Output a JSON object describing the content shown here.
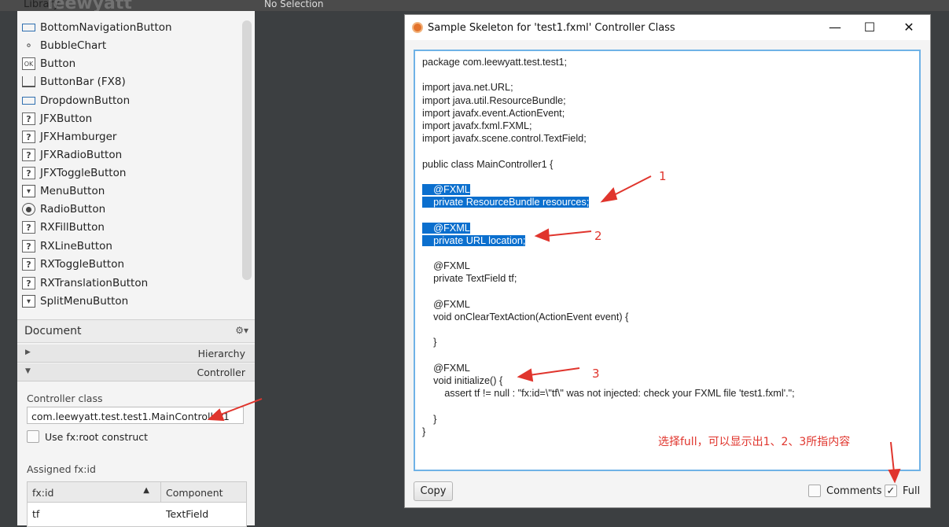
{
  "topbar": {
    "library_label": "Library",
    "watermark": "leewyatt",
    "status": "No Selection"
  },
  "library_items": [
    {
      "label": "BottomNavigationButton",
      "icon": "dropdown-icon"
    },
    {
      "label": "BubbleChart",
      "icon": "bubble-chart-icon"
    },
    {
      "label": "Button",
      "icon": "ok-button-icon"
    },
    {
      "label": "ButtonBar  (FX8)",
      "icon": "button-bar-icon"
    },
    {
      "label": "DropdownButton",
      "icon": "dropdown-icon"
    },
    {
      "label": "JFXButton",
      "icon": "unknown-component-icon"
    },
    {
      "label": "JFXHamburger",
      "icon": "unknown-component-icon"
    },
    {
      "label": "JFXRadioButton",
      "icon": "unknown-component-icon"
    },
    {
      "label": "JFXToggleButton",
      "icon": "unknown-component-icon"
    },
    {
      "label": "MenuButton",
      "icon": "menu-button-icon"
    },
    {
      "label": "RadioButton",
      "icon": "radio-icon"
    },
    {
      "label": "RXFillButton",
      "icon": "unknown-component-icon"
    },
    {
      "label": "RXLineButton",
      "icon": "unknown-component-icon"
    },
    {
      "label": "RXToggleButton",
      "icon": "unknown-component-icon"
    },
    {
      "label": "RXTranslationButton",
      "icon": "unknown-component-icon"
    },
    {
      "label": "SplitMenuButton",
      "icon": "menu-button-icon"
    }
  ],
  "document": {
    "title": "Document",
    "hierarchy": "Hierarchy",
    "controller": "Controller"
  },
  "controller": {
    "class_label": "Controller class",
    "class_value": "com.leewyatt.test.test1.MainController1",
    "root_label": "Use fx:root construct",
    "assigned_label": "Assigned fx:id",
    "col_fxid": "fx:id",
    "col_component": "Component",
    "rows": [
      {
        "fxid": "tf",
        "component": "TextField"
      }
    ]
  },
  "dialog": {
    "title": "Sample Skeleton for 'test1.fxml' Controller Class",
    "code": {
      "l1": "package com.leewyatt.test.test1;",
      "l2": "import java.net.URL;",
      "l3": "import java.util.ResourceBundle;",
      "l4": "import javafx.event.ActionEvent;",
      "l5": "import javafx.fxml.FXML;",
      "l6": "import javafx.scene.control.TextField;",
      "l7": "public class MainController1 {",
      "l8": "    @FXML",
      "l9": "    private ResourceBundle resources;",
      "l10": "    @FXML",
      "l11": "    private URL location;",
      "l12": "    @FXML",
      "l13": "    private TextField tf;",
      "l14": "    @FXML",
      "l15": "    void onClearTextAction(ActionEvent event) {",
      "l16": "    }",
      "l17": "    @FXML",
      "l18": "    void initialize() {",
      "l19": "        assert tf != null : \"fx:id=\\\"tf\\\" was not injected: check your FXML file 'test1.fxml'.\";",
      "l20": "    }",
      "l21": "}"
    },
    "copy_label": "Copy",
    "comments_label": "Comments",
    "full_label": "Full"
  },
  "annotations": {
    "n1": "1",
    "n2": "2",
    "n3": "3",
    "note": "选择full，可以显示出1、2、3所指内容",
    "color": "#e0352d"
  }
}
